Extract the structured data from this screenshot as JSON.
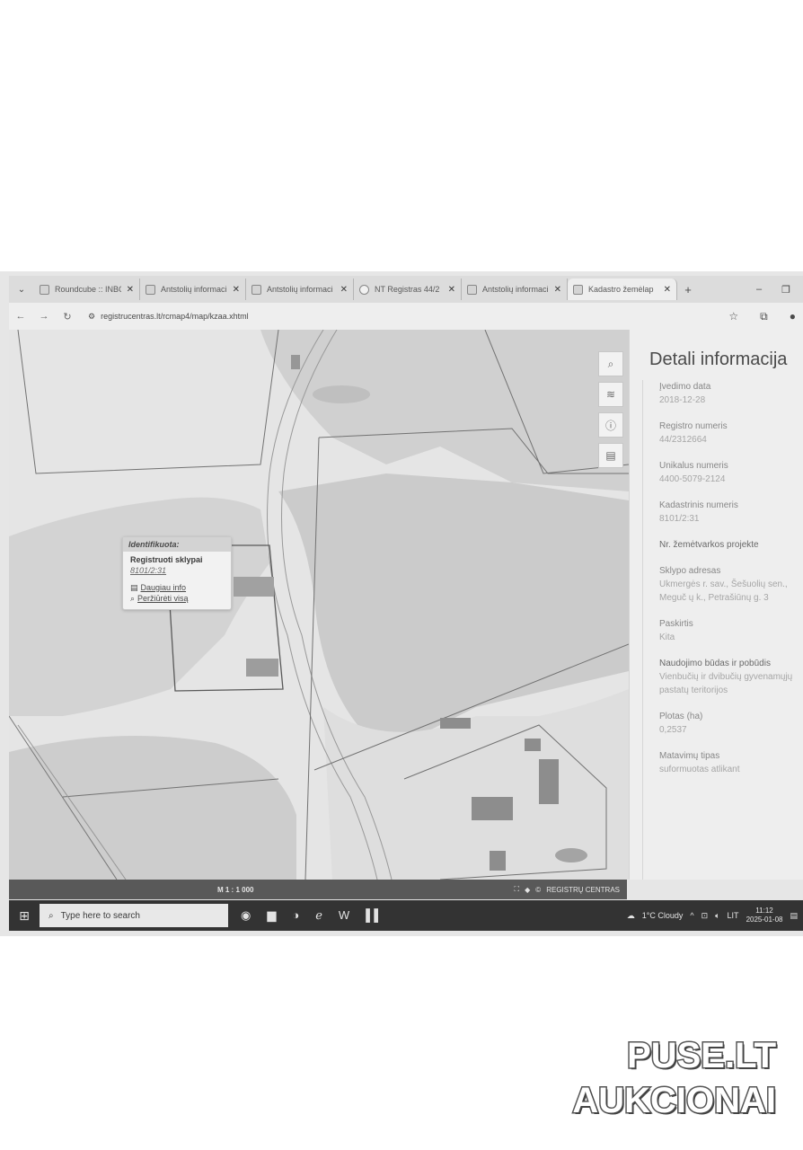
{
  "browser": {
    "tabs": [
      {
        "title": "Roundcube :: INBO",
        "active": false,
        "icon": "mail-icon"
      },
      {
        "title": "Antstolių informaci",
        "active": false,
        "icon": "site-icon"
      },
      {
        "title": "Antstolių informaci",
        "active": false,
        "icon": "site-icon"
      },
      {
        "title": "NT Registras 44/2",
        "active": false,
        "icon": "globe-icon"
      },
      {
        "title": "Antstolių informaci",
        "active": false,
        "icon": "site-icon"
      },
      {
        "title": "Kadastro žemėlap",
        "active": true,
        "icon": "site-icon"
      }
    ],
    "url": "registrucentras.lt/rcmap4/map/kzaa.xhtml"
  },
  "map": {
    "popup": {
      "header": "Identifikuota:",
      "title": "Registruoti sklypai",
      "code": "8101/2:31",
      "link_info": "Daugiau info",
      "link_view": "Peržiūrėti visą"
    },
    "scale": "M 1 : 1 000",
    "brand": "REGISTRŲ CENTRAS"
  },
  "panel": {
    "title": "Detali informacija",
    "fields": [
      {
        "label": "Įvedimo data",
        "value": "2018-12-28"
      },
      {
        "label": "Registro numeris",
        "value": "44/2312664"
      },
      {
        "label": "Unikalus numeris",
        "value": "4400-5079-2124"
      },
      {
        "label": "Kadastrinis numeris",
        "value": "8101/2:31"
      },
      {
        "label": "Nr. žemėtvarkos projekte",
        "value": ""
      },
      {
        "label": "Sklypo adresas",
        "value": "Ukmergės r. sav., Šešuolių sen., Meguč ų k., Petrašiūnų g. 3"
      },
      {
        "label": "Paskirtis",
        "value": "Kita"
      },
      {
        "label": "Naudojimo būdas ir pobūdis",
        "value": "Vienbučių ir dvibučių gyvenamųjų pastatų teritorijos"
      },
      {
        "label": "Plotas (ha)",
        "value": "0,2537"
      },
      {
        "label": "Matavimų tipas",
        "value": "suformuotas atlikant"
      }
    ]
  },
  "taskbar": {
    "search_placeholder": "Type here to search",
    "weather": "1°C Cloudy",
    "lang": "LIT",
    "time": "11:12",
    "date": "2025-01-08"
  },
  "watermark": {
    "line1": "PUSE.LT",
    "line2": "AUKCIONAI"
  }
}
